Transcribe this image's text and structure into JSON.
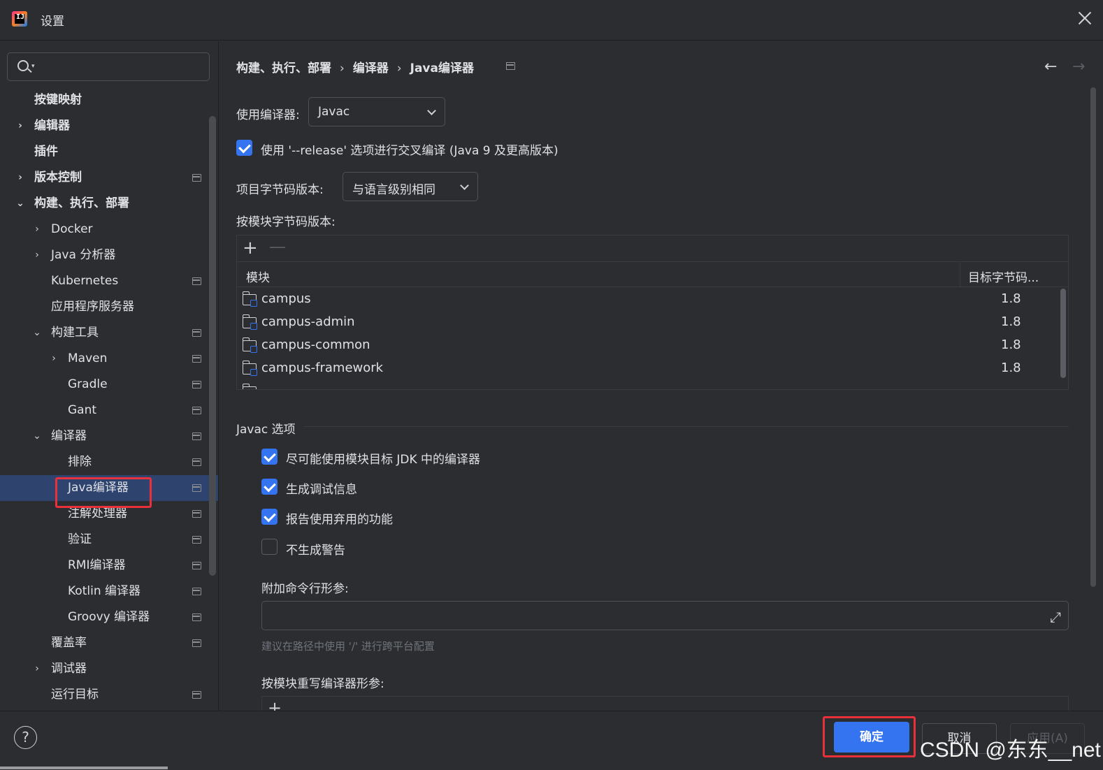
{
  "window": {
    "title": "设置"
  },
  "search": {
    "placeholder": ""
  },
  "sidebar": {
    "items": [
      {
        "label": "按键映射"
      },
      {
        "label": "编辑器"
      },
      {
        "label": "插件"
      },
      {
        "label": "版本控制"
      },
      {
        "label": "构建、执行、部署"
      },
      {
        "label": "Docker"
      },
      {
        "label": "Java 分析器"
      },
      {
        "label": "Kubernetes"
      },
      {
        "label": "应用程序服务器"
      },
      {
        "label": "构建工具"
      },
      {
        "label": "Maven"
      },
      {
        "label": "Gradle"
      },
      {
        "label": "Gant"
      },
      {
        "label": "编译器"
      },
      {
        "label": "排除"
      },
      {
        "label": "Java编译器"
      },
      {
        "label": "注解处理器"
      },
      {
        "label": "验证"
      },
      {
        "label": "RMI编译器"
      },
      {
        "label": "Kotlin 编译器"
      },
      {
        "label": "Groovy 编译器"
      },
      {
        "label": "覆盖率"
      },
      {
        "label": "调试器"
      },
      {
        "label": "运行目标"
      }
    ]
  },
  "breadcrumb": {
    "part1": "构建、执行、部署",
    "part2": "编译器",
    "part3": "Java编译器"
  },
  "compiler": {
    "use_compiler_label": "使用编译器:",
    "use_compiler_value": "Javac",
    "release_option_label": "使用 '--release' 选项进行交叉编译 (Java 9 及更高版本)",
    "release_option_checked": true,
    "bytecode_label": "项目字节码版本:",
    "bytecode_value": "与语言级别相同",
    "per_module_label": "按模块字节码版本:"
  },
  "module_table": {
    "col_module": "模块",
    "col_target": "目标字节码...",
    "rows": [
      {
        "name": "campus",
        "value": "1.8"
      },
      {
        "name": "campus-admin",
        "value": "1.8"
      },
      {
        "name": "campus-common",
        "value": "1.8"
      },
      {
        "name": "campus-framework",
        "value": "1.8"
      }
    ]
  },
  "javac": {
    "section_title": "Javac 选项",
    "options": [
      {
        "label": "尽可能使用模块目标 JDK 中的编译器",
        "checked": true
      },
      {
        "label": "生成调试信息",
        "checked": true
      },
      {
        "label": "报告使用弃用的功能",
        "checked": true
      },
      {
        "label": "不生成警告",
        "checked": false
      }
    ],
    "extra_args_label": "附加命令行形参:",
    "extra_args_value": "",
    "hint": "建议在路径中使用 '/' 进行跨平台配置",
    "override_label": "按模块重写编译器形参:"
  },
  "footer": {
    "ok": "确定",
    "cancel": "取消",
    "apply": "应用(A)",
    "watermark": "CSDN @东东__net"
  },
  "colors": {
    "accent": "#3574f0",
    "highlight": "#e8313a",
    "selected_bg": "#2e436e"
  }
}
